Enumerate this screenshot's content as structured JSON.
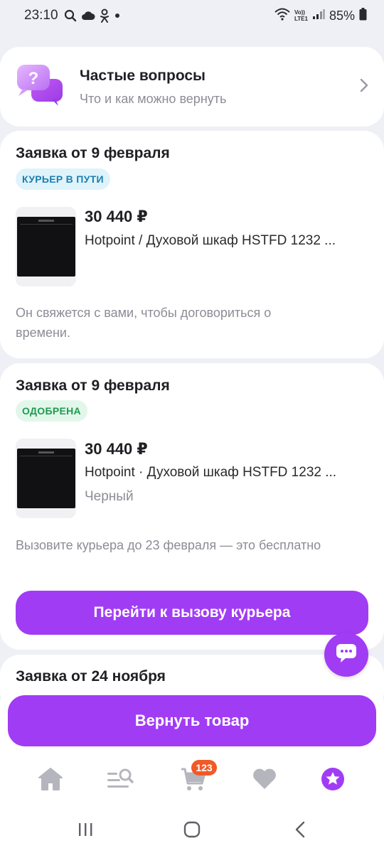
{
  "status_bar": {
    "time": "23:10",
    "battery": "85%",
    "icons": [
      "search-icon",
      "cloud-icon",
      "odnoklassniki-icon",
      "dot-icon",
      "wifi-icon",
      "volte-icon",
      "signal-icon",
      "battery-icon"
    ],
    "network_top": "Vo))",
    "network_bottom": "LTE1"
  },
  "faq": {
    "title": "Частые вопросы",
    "subtitle": "Что и как можно вернуть"
  },
  "orders": [
    {
      "title": "Заявка от 9 февраля",
      "status": "КУРЬЕР В ПУТИ",
      "price": "30 440 ₽",
      "product": "Hotpoint / Духовой шкаф HSTFD 1232 ...",
      "note": "Он свяжется с вами, чтобы договориться о времени."
    },
    {
      "title": "Заявка от 9 февраля",
      "status": "ОДОБРЕНА",
      "price": "30 440 ₽",
      "product": "Hotpoint · Духовой шкаф HSTFD 1232 ...",
      "color": "Черный",
      "note": "Вызовите курьера до 23 февраля — это бесплатно",
      "action": "Перейти к вызову курьера"
    },
    {
      "title": "Заявка от 24 ноября"
    }
  ],
  "return_button": "Вернуть товар",
  "tabbar": {
    "items": [
      "home-icon",
      "catalog-search-icon",
      "cart-icon",
      "favorites-icon",
      "profile-star-icon"
    ],
    "cart_count": "123"
  },
  "colors": {
    "accent": "#a13cf5",
    "courier_badge_bg": "#dff3fb",
    "courier_badge_text": "#1b7fb0",
    "approved_badge_bg": "#e2f7ea",
    "approved_badge_text": "#1f9a52",
    "cart_badge": "#f05a28"
  }
}
